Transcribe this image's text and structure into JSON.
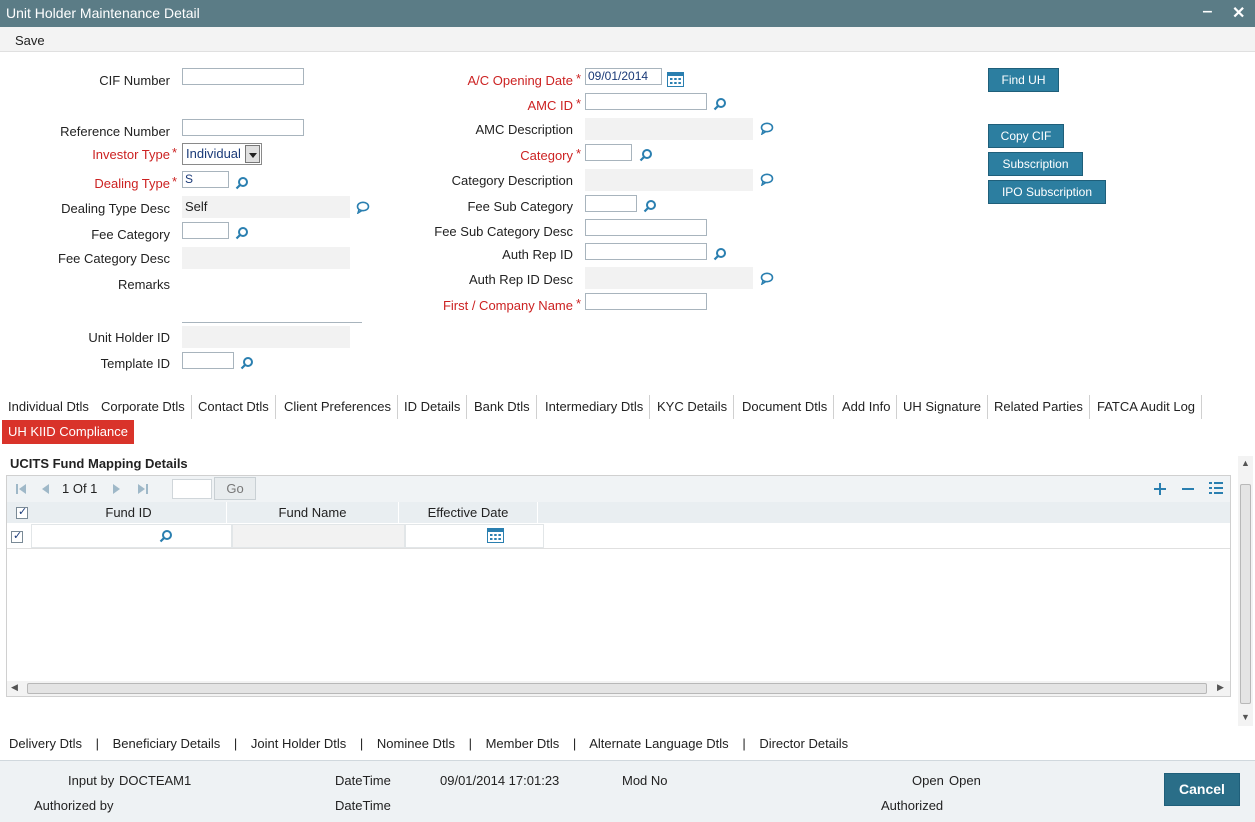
{
  "window": {
    "title": "Unit Holder Maintenance Detail",
    "minimize": "‒",
    "close": "✕"
  },
  "toolbar": {
    "save_label": "Save"
  },
  "left_form": {
    "cif_number_label": "CIF Number",
    "reference_number_label": "Reference Number",
    "investor_type_label": "Investor Type",
    "investor_type_value": "Individual",
    "dealing_type_label": "Dealing Type",
    "dealing_type_value": "S",
    "dealing_type_desc_label": "Dealing Type Desc",
    "dealing_type_desc_value": "Self",
    "fee_category_label": "Fee Category",
    "fee_category_desc_label": "Fee Category Desc",
    "remarks_label": "Remarks",
    "unit_holder_id_label": "Unit Holder ID",
    "template_id_label": "Template ID"
  },
  "middle_form": {
    "opening_date_label": "A/C Opening Date",
    "opening_date_value": "09/01/2014",
    "amc_id_label": "AMC ID",
    "amc_description_label": "AMC Description",
    "category_label": "Category",
    "category_description_label": "Category Description",
    "fee_sub_category_label": "Fee Sub Category",
    "fee_sub_category_desc_label": "Fee Sub Category Desc",
    "auth_rep_id_label": "Auth Rep ID",
    "auth_rep_id_desc_label": "Auth Rep ID Desc",
    "first_company_name_label": "First / Company Name"
  },
  "required_marker": "*",
  "right_buttons": {
    "find_uh": "Find UH",
    "copy_cif": "Copy CIF",
    "subscription": "Subscription",
    "ipo_subscription": "IPO Subscription"
  },
  "tabs": [
    "Individual Dtls",
    "Corporate Dtls",
    "Contact Dtls",
    "Client Preferences",
    "ID Details",
    "Bank Dtls",
    "Intermediary Dtls",
    "KYC Details",
    "Document Dtls",
    "Add Info",
    "UH Signature",
    "Related Parties",
    "FATCA Audit Log",
    "UH KIID Compliance"
  ],
  "active_tab": "UH KIID Compliance",
  "section": {
    "title": "UCITS Fund Mapping Details",
    "pager_text": "1 Of 1",
    "go_label": "Go",
    "columns": [
      "Fund ID",
      "Fund Name",
      "Effective Date"
    ]
  },
  "bottom_links": [
    "Delivery Dtls",
    "Beneficiary Details",
    "Joint Holder Dtls",
    "Nominee Dtls",
    "Member Dtls",
    "Alternate Language Dtls",
    "Director Details"
  ],
  "link_separator": "|",
  "footer": {
    "input_by_label": "Input by",
    "input_by_value": "DOCTEAM1",
    "datetime_label": "DateTime",
    "datetime_value": "09/01/2014 17:01:23",
    "mod_no_label": "Mod No",
    "open_label": "Open",
    "open_value": "Open",
    "authorized_by_label": "Authorized by",
    "datetime2_label": "DateTime",
    "authorized_label": "Authorized",
    "cancel_label": "Cancel"
  },
  "colors": {
    "titlebar": "#5b7c86",
    "accent": "#2c7ea0",
    "required": "#cc2222",
    "active_tab": "#d9332a"
  }
}
